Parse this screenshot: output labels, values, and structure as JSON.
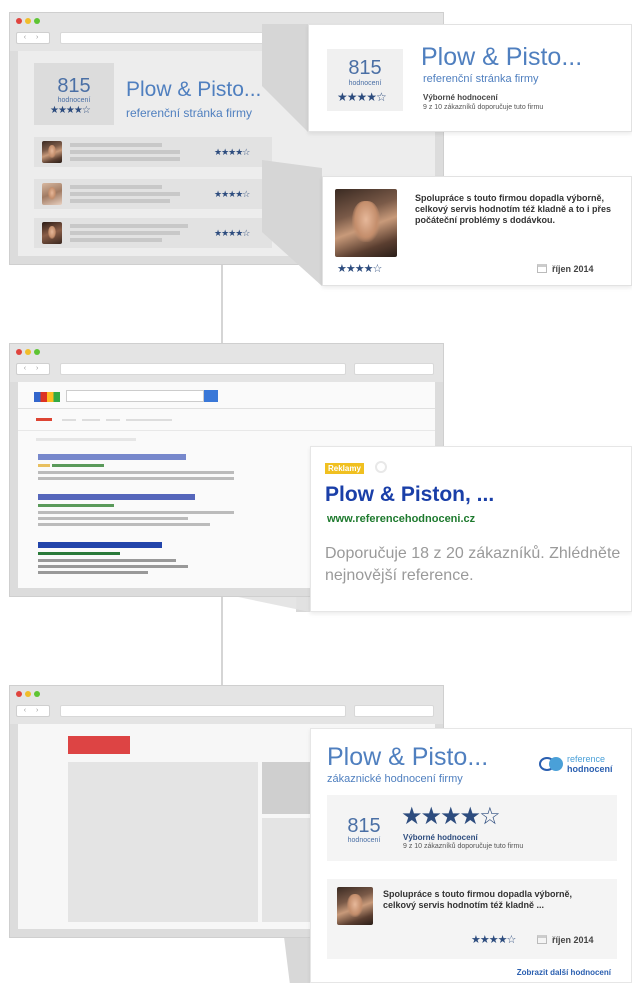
{
  "panel1": {
    "summary": {
      "count": "815",
      "count_label": "hodnocení",
      "company": "Plow & Pisto...",
      "subtitle": "referenční stránka firmy"
    },
    "review_rows": [
      {
        "stars": "★★★★☆"
      },
      {
        "stars": "★★★★☆"
      },
      {
        "stars": "★★★★☆"
      }
    ],
    "popup": {
      "count": "815",
      "count_label": "hodnocení",
      "company": "Plow & Pisto...",
      "subtitle": "referenční stránka firmy",
      "rating_label": "Výborné hodnocení",
      "recommend_text": "9 z 10 zákazníků doporučuje tuto firmu",
      "stars": "★★★★☆"
    },
    "review": {
      "text": "Spolupráce s touto firmou dopadla výborně, celkový servis hodnotím též kladně a to i přes počáteční problémy s dodávkou.",
      "stars": "★★★★☆",
      "date": "říjen 2014"
    }
  },
  "panel2": {
    "ad": {
      "badge": "Reklamy",
      "title": "Plow & Piston, ...",
      "url": "www.referencehodnoceni.cz",
      "description": "Doporučuje 18 z 20 zákazníků. Zhlédněte nejnovější reference."
    }
  },
  "panel3": {
    "widget": {
      "company": "Plow & Pisto...",
      "subtitle": "zákaznické hodnocení firmy",
      "logo_line1": "reference",
      "logo_line2": "hodnocení",
      "count": "815",
      "count_label": "hodnocení",
      "stars": "★★★★☆",
      "rating_label": "Výborné hodnocení",
      "recommend_text": "9 z 10 zákazníků doporučuje tuto firmu",
      "review_text": "Spolupráce s touto firmou dopadla výborně, celkový servis hodnotím též kladně ...",
      "review_stars": "★★★★☆",
      "review_date": "říjen 2014",
      "more_link": "Zobrazit další hodnocení"
    }
  },
  "colors": {
    "accent_blue": "#4f7fbf",
    "star_navy": "#2d4c7e",
    "ad_title": "#1a3fa8",
    "ad_url": "#1e7a2e",
    "ad_badge": "#f0c020",
    "link_blue": "#2a5fb0"
  },
  "icons": {
    "calendar": "calendar-icon",
    "browser_dots": "window-controls-icon",
    "logo": "reference-hodnoceni-logo-icon"
  }
}
